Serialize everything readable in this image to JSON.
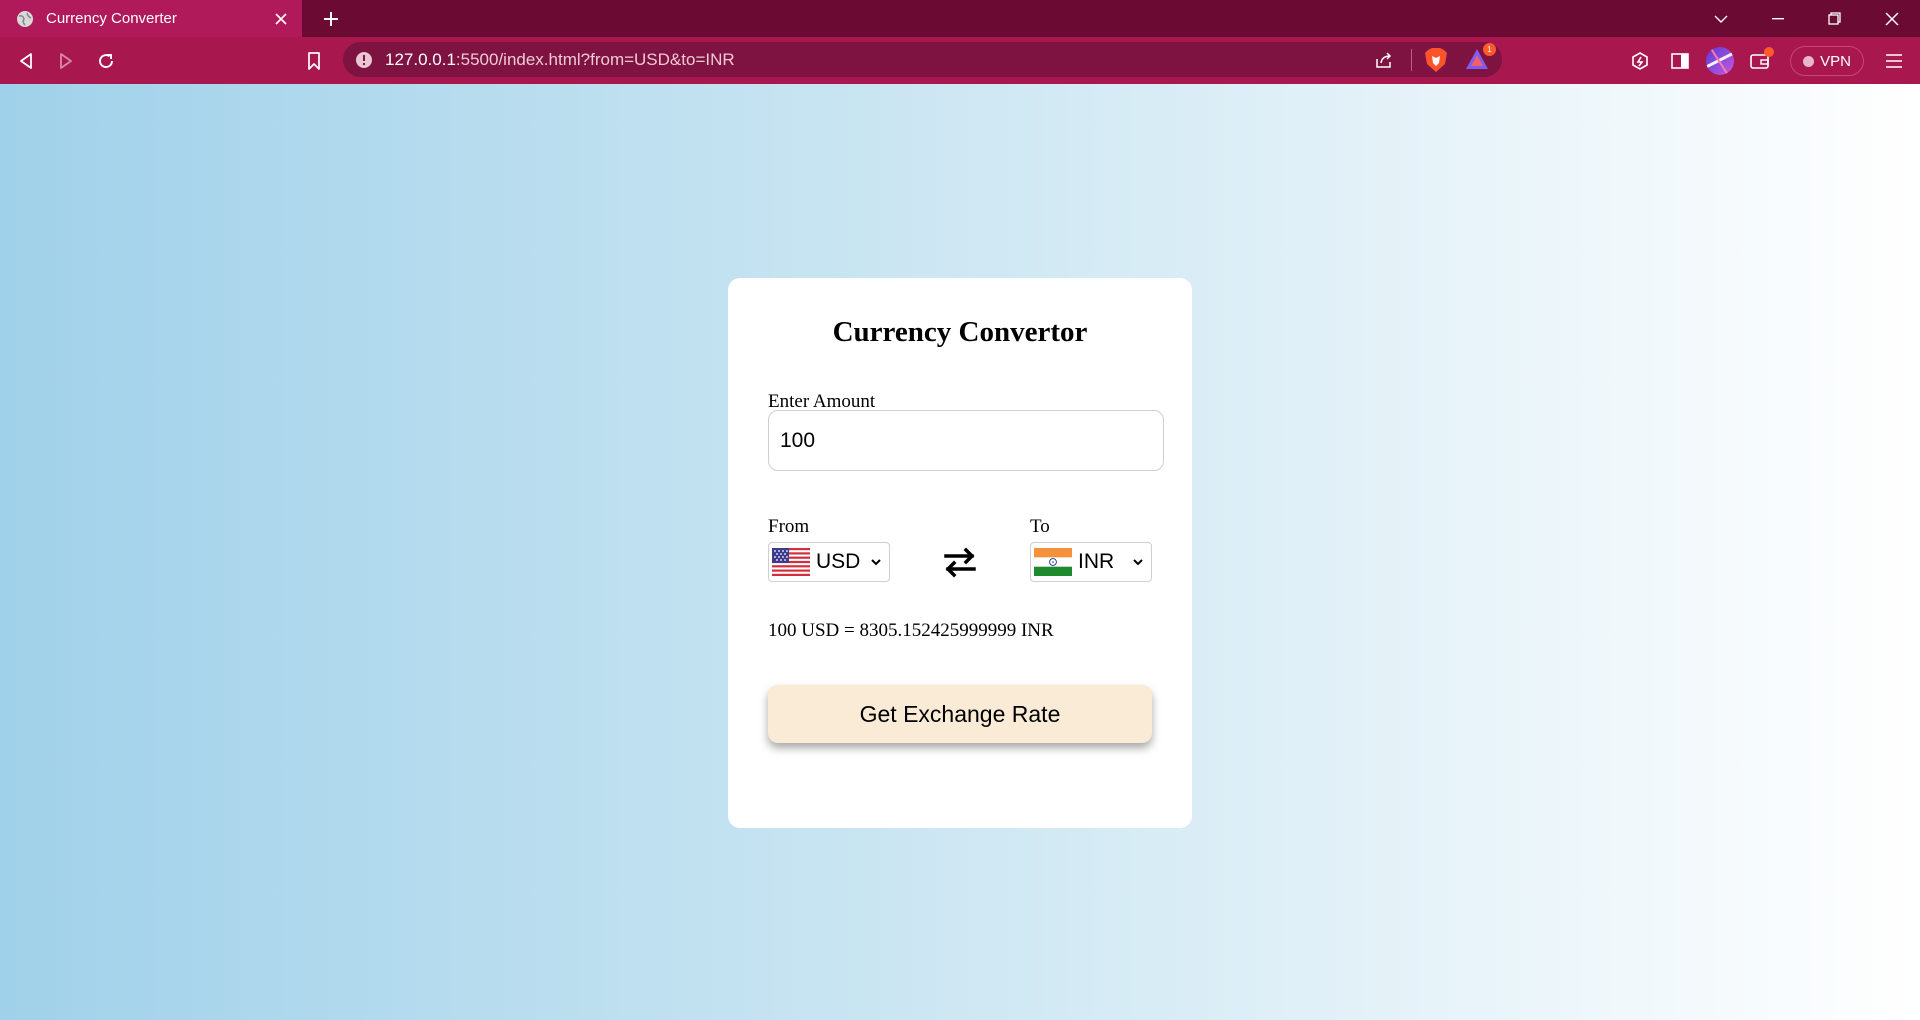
{
  "browser": {
    "tab_title": "Currency Converter",
    "url_host": "127.0.0.1",
    "url_rest": ":5500/index.html?from=USD&to=INR",
    "vpn_label": "VPN",
    "rewards_badge": "1"
  },
  "app": {
    "title": "Currency Convertor",
    "amount_label": "Enter Amount",
    "amount_value": "100",
    "from_label": "From",
    "to_label": "To",
    "from_currency": "USD",
    "to_currency": "INR",
    "result_text": "100 USD = 8305.152425999999 INR",
    "button_label": "Get Exchange Rate"
  },
  "icons": {
    "tab_favicon": "globe-icon",
    "swap": "swap-arrows-icon",
    "from_flag": "us-flag-icon",
    "to_flag": "india-flag-icon"
  },
  "colors": {
    "tabbar": "#6b0a33",
    "tab_active": "#b0195a",
    "toolbar": "#a8184f",
    "address_bar": "#7e1240",
    "button_bg": "#faebd7",
    "page_gradient_start": "#a0d1ea",
    "page_gradient_end": "#ffffff"
  }
}
